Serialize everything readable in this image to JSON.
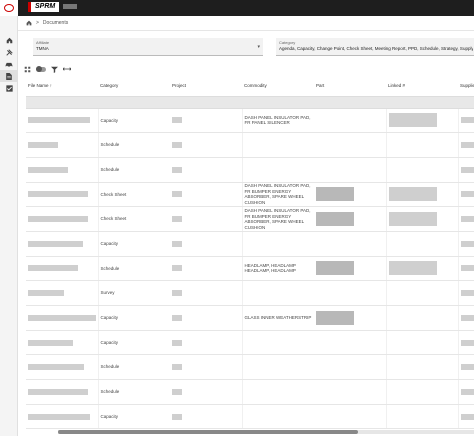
{
  "breadcrumb": {
    "separator": ">",
    "current": "Documents"
  },
  "filters": {
    "affiliate": {
      "label": "Affiliate",
      "value": "TMNA"
    },
    "category": {
      "label": "Category",
      "value": "Agenda, Capacity, Change Point, Check Sheet, Meeting Report, PPD, Schedule, Strategy, Supply Chain, Survey"
    }
  },
  "table": {
    "columns": [
      "File Name",
      "Category",
      "Project",
      "Commodity",
      "Part",
      "Linked #",
      "Supplier"
    ],
    "sort_indicator": "↑",
    "rows": [
      {
        "category": "Capacity",
        "commodity": "DASH PANEL INSULATOR PAD, FR PANEL SILENCER"
      },
      {
        "category": "Schedule",
        "commodity": ""
      },
      {
        "category": "Schedule",
        "commodity": ""
      },
      {
        "category": "Check Sheet",
        "commodity": "DASH PANEL INSULATOR PAD, FR BUMPER ENERGY ABSORBER, SPARE WHEEL CUSHION"
      },
      {
        "category": "Check Sheet",
        "commodity": "DASH PANEL INSULATOR PAD, FR BUMPER ENERGY ABSORBER, SPARE WHEEL CUSHION"
      },
      {
        "category": "Capacity",
        "commodity": ""
      },
      {
        "category": "Schedule",
        "commodity": "HEADLAMP, HEADLAMP HEADLAMP, HEADLAMP"
      },
      {
        "category": "Survey",
        "commodity": ""
      },
      {
        "category": "Capacity",
        "commodity": "GLASS INNER WEATHERSTRIP"
      },
      {
        "category": "Capacity",
        "commodity": ""
      },
      {
        "category": "Schedule",
        "commodity": ""
      },
      {
        "category": "Schedule",
        "commodity": ""
      },
      {
        "category": "Capacity",
        "commodity": ""
      }
    ]
  },
  "colors": {
    "topbar": "#1e1e1e",
    "brand_accent": "#cc0000"
  },
  "icons": [
    "home-icon",
    "tools-icon",
    "car-icon",
    "document-icon",
    "checkbox-icon",
    "toggle-icon",
    "filter-icon",
    "resize-icon"
  ]
}
